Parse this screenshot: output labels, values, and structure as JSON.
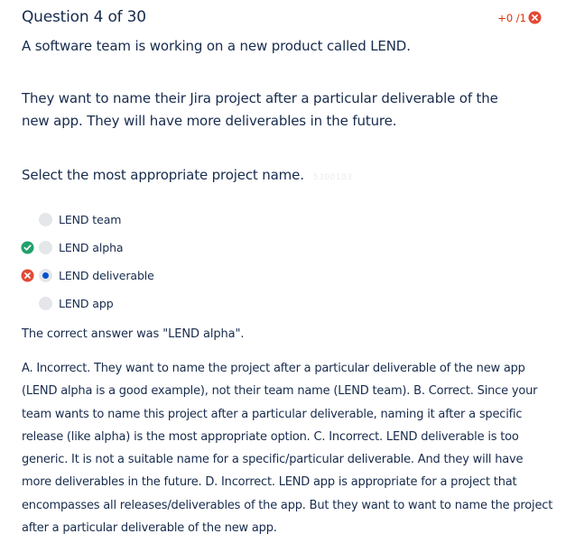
{
  "question": {
    "title": "Question 4 of 30",
    "score": "+0 /1",
    "prompt_line1": "A software team is working on a new product called LEND.",
    "prompt_line2": "They want to name their Jira project after a particular deliverable of the new app. They will have more deliverables in the future.",
    "prompt_line3": "Select the most appropriate project name.",
    "watermark": "5300103"
  },
  "options": [
    {
      "label": "LEND team",
      "status": "none",
      "selected": false
    },
    {
      "label": "LEND alpha",
      "status": "correct",
      "selected": false
    },
    {
      "label": "LEND deliverable",
      "status": "incorrect",
      "selected": true
    },
    {
      "label": "LEND app",
      "status": "none",
      "selected": false
    }
  ],
  "result": {
    "correct_answer_text": "The correct answer was \"LEND alpha\".",
    "explanation": "A. Incorrect. They want to name the project after a particular deliverable of the new app (LEND alpha is a good example), not their team name (LEND team). B. Correct. Since your team wants to name this project after a particular deliverable, naming it after a specific release (like alpha) is the most appropriate option. C. Incorrect. LEND deliverable is too generic. It is not a suitable name for a specific/particular deliverable. And they will have more deliverables in the future. D. Incorrect. LEND app is appropriate for a project that encompasses all releases/deliverables of the app. But they want to want to name the project after a particular deliverable of the new app."
  },
  "colors": {
    "correct": "#22a06b",
    "incorrect": "#e34935",
    "selected_dot": "#0052cc",
    "radio_bg": "#e4e6ea",
    "text": "#172b4d"
  },
  "icons": {
    "correct": "check-circle-icon",
    "incorrect": "x-circle-icon"
  }
}
